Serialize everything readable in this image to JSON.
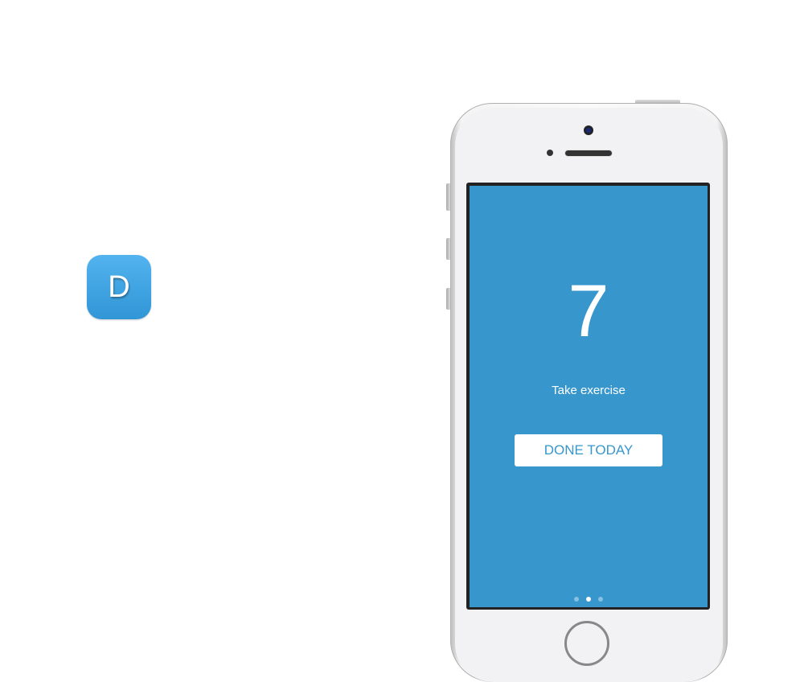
{
  "app_icon": {
    "letter": "D"
  },
  "screen": {
    "number": "7",
    "habit": "Take exercise",
    "button_label": "DONE TODAY",
    "page_indicator": {
      "count": 3,
      "active": 2
    }
  },
  "colors": {
    "accent": "#3797cd"
  }
}
